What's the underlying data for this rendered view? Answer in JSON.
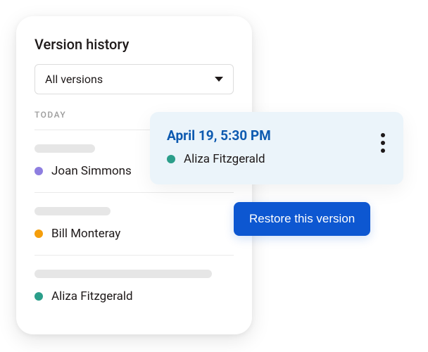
{
  "panel": {
    "title": "Version history",
    "filter": {
      "selected": "All versions"
    },
    "sectionLabel": "TODAY",
    "items": [
      {
        "author": "Joan Simmons",
        "dotColor": "#8e7ee0",
        "skeletonWidthClass": "sk-sm"
      },
      {
        "author": "Bill Monteray",
        "dotColor": "#f59e0b",
        "skeletonWidthClass": "sk-md"
      },
      {
        "author": "Aliza Fitzgerald",
        "dotColor": "#2b9e8a",
        "skeletonWidthClass": "sk-lg"
      }
    ]
  },
  "popover": {
    "timestamp": "April 19, 5:30 PM",
    "author": "Aliza Fitzgerald",
    "dotColor": "#2b9e8a"
  },
  "restore": {
    "label": "Restore this version"
  }
}
